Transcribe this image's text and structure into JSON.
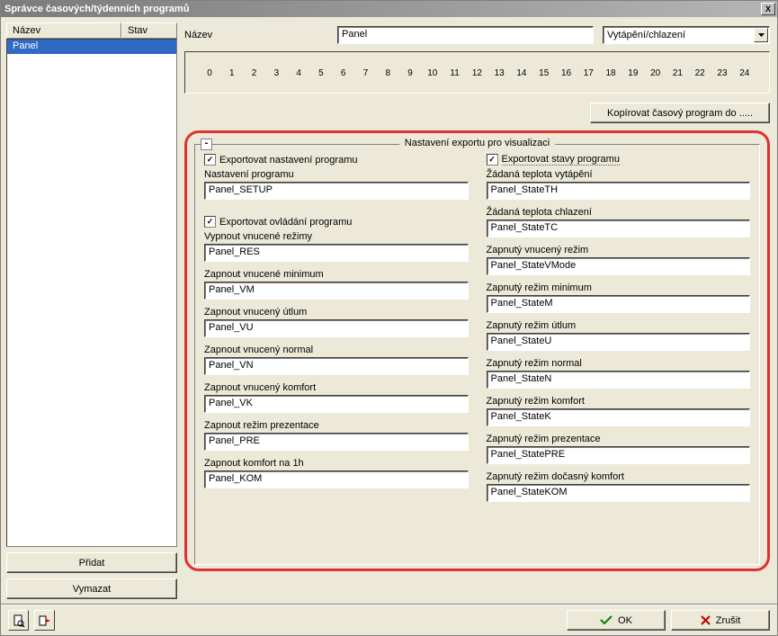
{
  "window": {
    "title": "Správce časových/týdenních programů"
  },
  "leftPanel": {
    "colName": "Název",
    "colState": "Stav",
    "rows": [
      {
        "name": "Panel",
        "state": ""
      }
    ],
    "addBtn": "Přidat",
    "deleteBtn": "Vymazat"
  },
  "topForm": {
    "nameLabel": "Název",
    "nameValue": "Panel",
    "modeValue": "Vytápění/chlazení"
  },
  "timeline": [
    "0",
    "1",
    "2",
    "3",
    "4",
    "5",
    "6",
    "7",
    "8",
    "9",
    "10",
    "11",
    "12",
    "13",
    "14",
    "15",
    "16",
    "17",
    "18",
    "19",
    "20",
    "21",
    "22",
    "23",
    "24"
  ],
  "copyBtn": "Kopírovat časový program do .....",
  "exportGroup": {
    "title": "Nastavení exportu pro visualizaci",
    "collapse": "-",
    "left": {
      "chk1": "Exportovat nastavení programu",
      "l1": "Nastavení programu",
      "v1": "Panel_SETUP",
      "chk2": "Exportovat ovládání programu",
      "l2": "Vypnout vnucené režimy",
      "v2": "Panel_RES",
      "l3": "Zapnout vnucené minimum",
      "v3": "Panel_VM",
      "l4": "Zapnout vnucený útlum",
      "v4": "Panel_VU",
      "l5": "Zapnout vnucený normal",
      "v5": "Panel_VN",
      "l6": "Zapnout vnucený komfort",
      "v6": "Panel_VK",
      "l7": "Zapnout režim prezentace",
      "v7": "Panel_PRE",
      "l8": "Zapnout komfort na 1h",
      "v8": "Panel_KOM"
    },
    "right": {
      "chk1": "Exportovat stavy programu",
      "l1": "Žádaná teplota vytápění",
      "v1": "Panel_StateTH",
      "l2": "Žádaná teplota chlazení",
      "v2": "Panel_StateTC",
      "l3": "Zapnutý vnucený režim",
      "v3": "Panel_StateVMode",
      "l4": "Zapnutý režim minimum",
      "v4": "Panel_StateM",
      "l5": "Zapnutý režim útlum",
      "v5": "Panel_StateU",
      "l6": "Zapnutý režim normal",
      "v6": "Panel_StateN",
      "l7": "Zapnutý režim komfort",
      "v7": "Panel_StateK",
      "l8": "Zapnutý režim prezentace",
      "v8": "Panel_StatePRE",
      "l9": "Zapnutý režim dočasný komfort",
      "v9": "Panel_StateKOM"
    }
  },
  "bottom": {
    "ok": "OK",
    "cancel": "Zrušit"
  }
}
